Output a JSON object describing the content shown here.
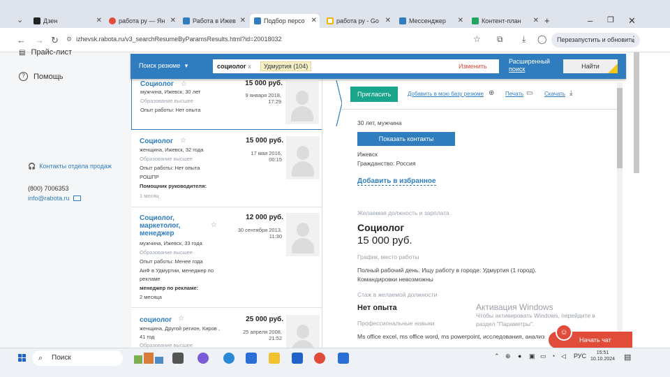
{
  "browser": {
    "tabs": [
      {
        "label": "Дзен",
        "color": "#222222"
      },
      {
        "label": "работа ру — Ян",
        "color": "#e04b3a"
      },
      {
        "label": "Работа в Ижев",
        "color": "#2f7dbf"
      },
      {
        "label": "Подбор персо",
        "color": "#2f7dbf"
      },
      {
        "label": "работа ру - Go",
        "color": "#f5b400"
      },
      {
        "label": "Мессенджер",
        "color": "#2f7dbf"
      },
      {
        "label": "Контент-план",
        "color": "#1fa463"
      }
    ],
    "new_tab": "+",
    "url": "izhevsk.rabota.ru/v3_searchResumeByParamsResults.html?id=20018032",
    "restart_label": "Перезапустить и обновить"
  },
  "sidebar": {
    "items": [
      {
        "label": "Прайс-лист"
      },
      {
        "label": "Помощь"
      }
    ],
    "sales_contacts": "Контакты отдела продаж",
    "phone": "(800) 7006353",
    "email": "info@rabota.ru"
  },
  "search": {
    "mode_label": "Поиск резюме",
    "query": "социолог",
    "query_clear": "x",
    "region_tag": "Удмуртия (104)",
    "change_label": "Изменить",
    "advanced_line1": "Расширенный",
    "advanced_line2": "поиск",
    "find_label": "Найти"
  },
  "results": [
    {
      "title": "Социолог",
      "salary": "15 000 руб.",
      "date_line1": "9 января 2018,",
      "date_line2": "17:29",
      "person": "мужчина, Ижевск, 30 лет",
      "education": "Образование высшее",
      "experience": "Опыт работы: Нет опыта"
    },
    {
      "title": "Социолог",
      "salary": "15 000 руб.",
      "date_line1": "17 мая 2016,",
      "date_line2": "00:15",
      "person": "женщина, Ижевск, 32 года",
      "education": "Образование высшее",
      "experience": "Опыт работы: Нет опыта",
      "company": "РОШПР",
      "role": "Помощник руководителя:",
      "duration": "1 месяц"
    },
    {
      "title_line1": "Социолог,",
      "title_line2": "маркетолог,",
      "title_line3": "менеджер",
      "salary": "12 000 руб.",
      "date_line1": "30 сентября 2013,",
      "date_line2": "11:30",
      "person": "мужчина, Ижевск, 33 года",
      "education": "Образование высшее",
      "experience": "Опыт работы: Менее года",
      "company_line1": "АиФ в Удмуртии, менеджер по",
      "company_line2": "рекламе",
      "role": "менеджер по рекламе:",
      "duration": "2 месяца"
    },
    {
      "title": "социолог",
      "salary": "25 000 руб.",
      "date_line1": "25 апреля 2008,",
      "date_line2": "21:52",
      "person_line1": "женщина, Другой регион, Киров ,",
      "person_line2": "41 год",
      "education": "Образование высшее"
    }
  ],
  "detail": {
    "invite_label": "Пригласить",
    "notebook_link": "Добавить в мою базу резюме",
    "print_link": "Печать",
    "download_link": "Скачать",
    "person": "30 лет, мужчина",
    "show_contacts": "Показать контакты",
    "city": "Ижевск",
    "citizenship": "Гражданство: Россия",
    "add_favorites": "Добавить в избранное",
    "desired_section": "Желаемая должность и зарплата",
    "position": "Социолог",
    "salary": "15 000 руб.",
    "schedule_section": "График, место работы",
    "schedule_text": "Полный рабочий день. Ищу работу в городе: Удмуртия (1 город).",
    "trips_text": "Командировки невозможны",
    "experience_section": "Стаж в желаемой должности",
    "experience_value": "Нет опыта",
    "skills_section": "Профессиональные навыки",
    "skills_text": "Ms office excel, ms office word, ms powerpoint, исследования, анализ"
  },
  "watermark": {
    "line1": "Активация Windows",
    "line2": "Чтобы активировать Windows, перейдите в",
    "line3": "раздел \"Параметры\"."
  },
  "chat": {
    "label": "Начать чат"
  },
  "taskbar": {
    "search_label": "Поиск",
    "lang": "РУС",
    "time": "15:51",
    "date": "10.10.2024"
  }
}
